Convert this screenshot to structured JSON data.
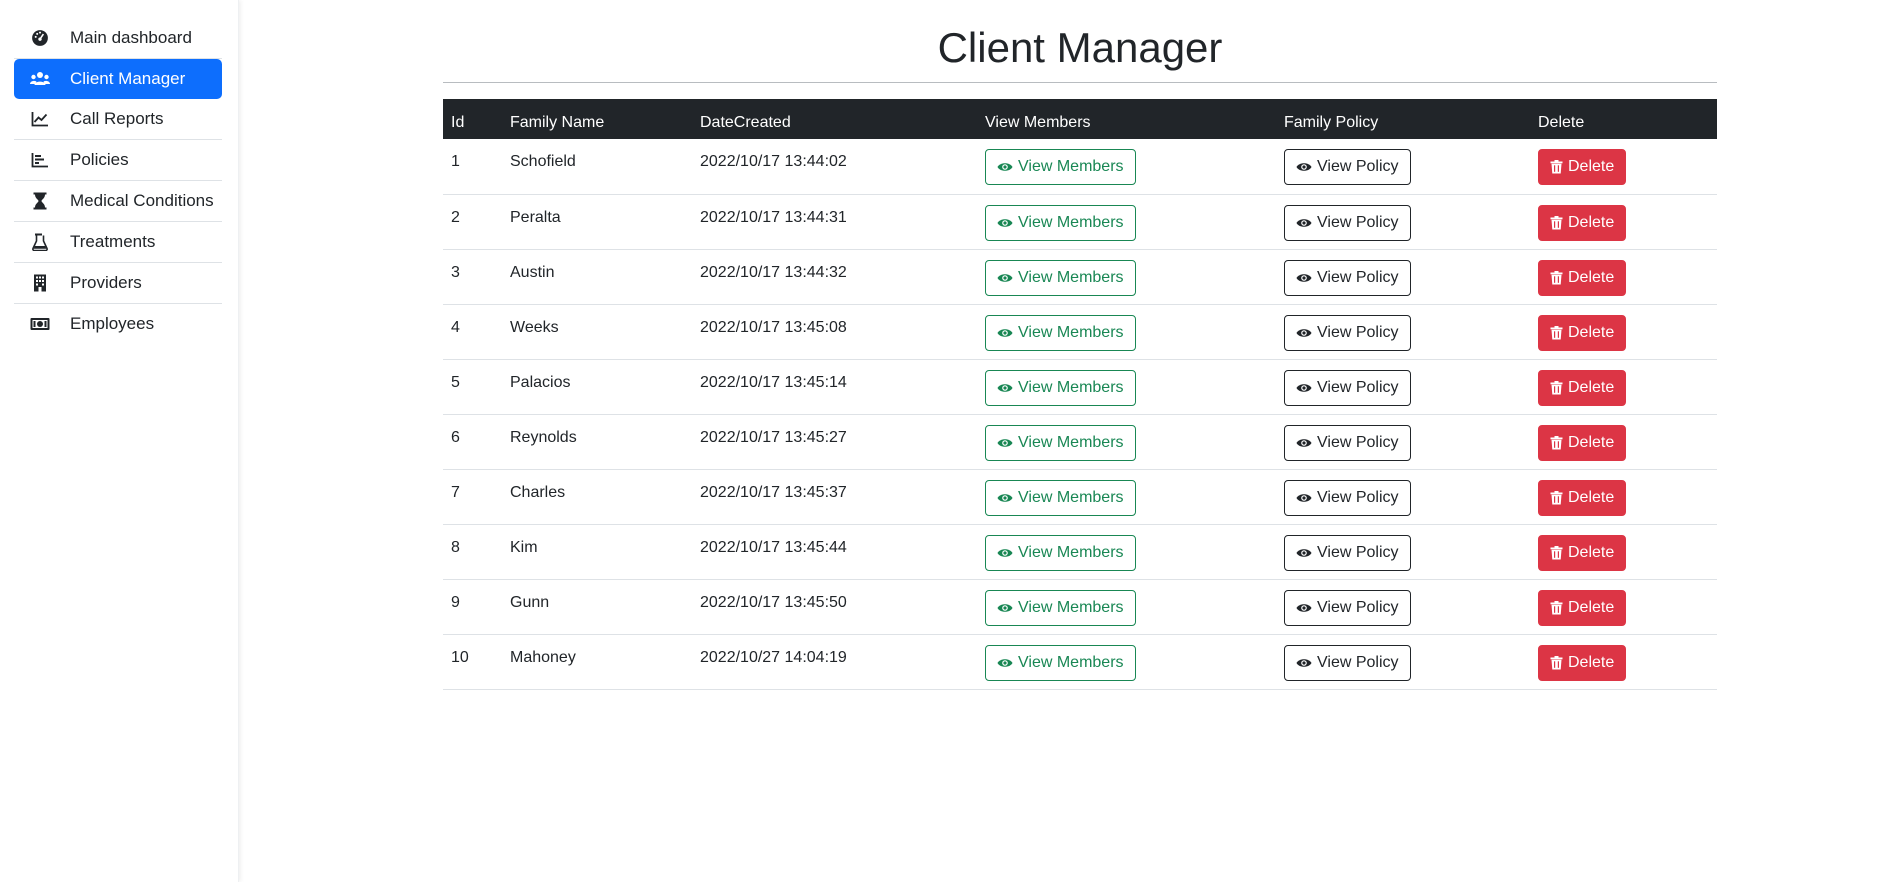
{
  "sidebar": {
    "items": [
      {
        "label": "Main dashboard",
        "icon": "dashboard-icon",
        "active": false
      },
      {
        "label": "Client Manager",
        "icon": "users-icon",
        "active": true
      },
      {
        "label": "Call Reports",
        "icon": "line-chart-icon",
        "active": false
      },
      {
        "label": "Policies",
        "icon": "bar-chart-icon",
        "active": false
      },
      {
        "label": "Medical Conditions",
        "icon": "hourglass-icon",
        "active": false
      },
      {
        "label": "Treatments",
        "icon": "flask-icon",
        "active": false
      },
      {
        "label": "Providers",
        "icon": "building-icon",
        "active": false
      },
      {
        "label": "Employees",
        "icon": "money-icon",
        "active": false
      }
    ]
  },
  "page": {
    "title": "Client Manager"
  },
  "table": {
    "headers": [
      "Id",
      "Family Name",
      "DateCreated",
      "View Members",
      "Family Policy",
      "Delete"
    ],
    "buttons": {
      "view_members": "View Members",
      "view_policy": "View Policy",
      "delete": "Delete"
    },
    "rows": [
      {
        "id": "1",
        "family_name": "Schofield",
        "date_created": "2022/10/17 13:44:02"
      },
      {
        "id": "2",
        "family_name": "Peralta",
        "date_created": "2022/10/17 13:44:31"
      },
      {
        "id": "3",
        "family_name": "Austin",
        "date_created": "2022/10/17 13:44:32"
      },
      {
        "id": "4",
        "family_name": "Weeks",
        "date_created": "2022/10/17 13:45:08"
      },
      {
        "id": "5",
        "family_name": "Palacios",
        "date_created": "2022/10/17 13:45:14"
      },
      {
        "id": "6",
        "family_name": "Reynolds",
        "date_created": "2022/10/17 13:45:27"
      },
      {
        "id": "7",
        "family_name": "Charles",
        "date_created": "2022/10/17 13:45:37"
      },
      {
        "id": "8",
        "family_name": "Kim",
        "date_created": "2022/10/17 13:45:44"
      },
      {
        "id": "9",
        "family_name": "Gunn",
        "date_created": "2022/10/17 13:45:50"
      },
      {
        "id": "10",
        "family_name": "Mahoney",
        "date_created": "2022/10/27 14:04:19"
      }
    ]
  },
  "colors": {
    "primary": "#0d6efd",
    "success": "#198754",
    "danger": "#dc3545",
    "dark": "#212529"
  }
}
